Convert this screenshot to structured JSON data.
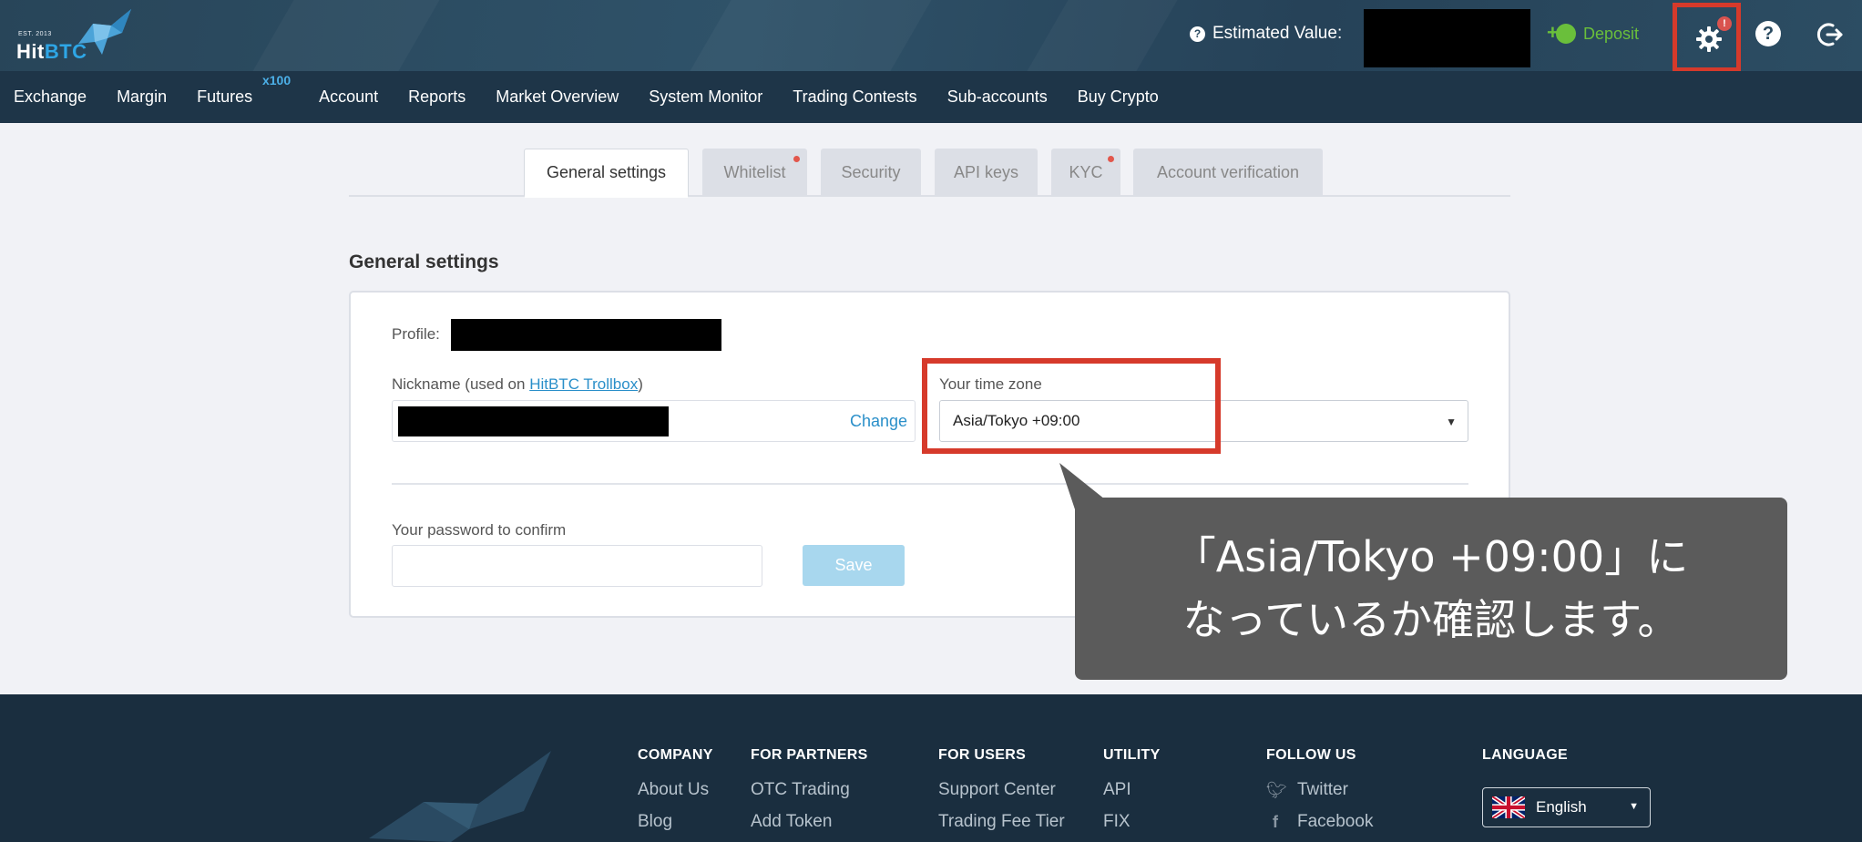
{
  "header": {
    "logo": {
      "est": "EST. 2013",
      "brand_a": "Hit",
      "brand_b": "BTC"
    },
    "estimated_value_label": "Estimated Value:",
    "deposit_label": "Deposit",
    "gear_badge": "!"
  },
  "nav": {
    "items": [
      "Exchange",
      "Margin",
      "Futures",
      "Account",
      "Reports",
      "Market Overview",
      "System Monitor",
      "Trading Contests",
      "Sub-accounts",
      "Buy Crypto"
    ],
    "futures_badge": "x100"
  },
  "tabs": [
    {
      "label": "General settings",
      "active": true,
      "dot": false
    },
    {
      "label": "Whitelist",
      "active": false,
      "dot": true
    },
    {
      "label": "Security",
      "active": false,
      "dot": false
    },
    {
      "label": "API keys",
      "active": false,
      "dot": false
    },
    {
      "label": "KYC",
      "active": false,
      "dot": true
    },
    {
      "label": "Account verification",
      "active": false,
      "dot": false
    }
  ],
  "settings": {
    "title": "General settings",
    "profile_label": "Profile:",
    "nickname_label_prefix": "Nickname (used on ",
    "nickname_link": "HitBTC Trollbox",
    "nickname_label_suffix": ")",
    "change_label": "Change",
    "timezone_label": "Your time zone",
    "timezone_value": "Asia/Tokyo +09:00",
    "password_label": "Your password to confirm",
    "save_label": "Save"
  },
  "callout": {
    "line1": "「Asia/Tokyo +09:00」に",
    "line2": "なっているか確認します。"
  },
  "footer": {
    "columns": [
      {
        "head": "COMPANY",
        "links": [
          "About Us",
          "Blog"
        ]
      },
      {
        "head": "FOR PARTNERS",
        "links": [
          "OTC Trading",
          "Add Token"
        ]
      },
      {
        "head": "FOR USERS",
        "links": [
          "Support Center",
          "Trading Fee Tier"
        ]
      },
      {
        "head": "UTILITY",
        "links": [
          "API",
          "FIX"
        ]
      },
      {
        "head": "FOLLOW US",
        "links": [
          "Twitter",
          "Facebook"
        ]
      }
    ],
    "language_head": "LANGUAGE",
    "language_value": "English"
  },
  "colors": {
    "header_bg": "#284559",
    "nav_bg": "#1e3548",
    "accent_blue": "#2a8fc9",
    "deposit_green": "#6abf3b",
    "highlight_red": "#d63a2b",
    "footer_bg": "#1a2e3f"
  }
}
